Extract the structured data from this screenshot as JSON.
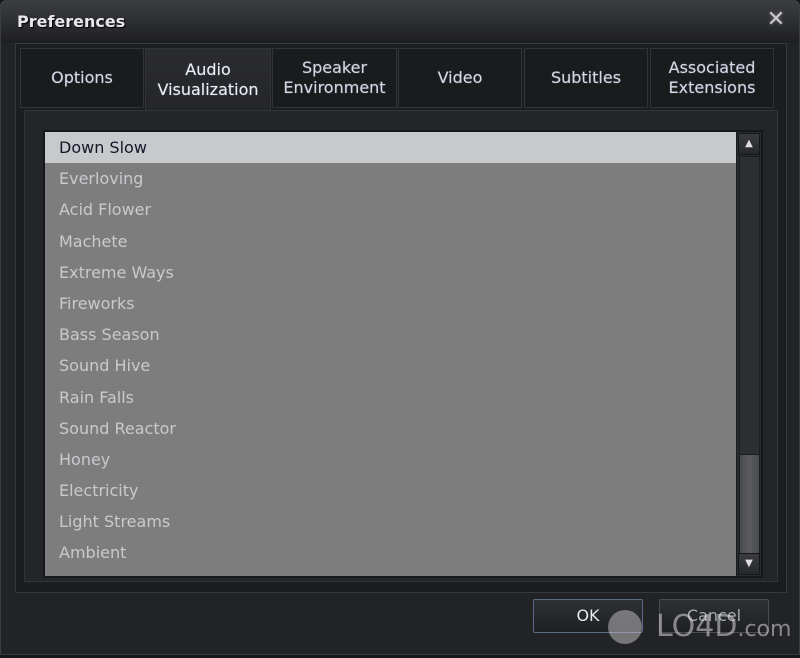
{
  "window": {
    "title": "Preferences",
    "close_icon": "close-icon"
  },
  "tabs": [
    {
      "line1": "Options",
      "line2": "",
      "active": false
    },
    {
      "line1": "Audio",
      "line2": "Visualization",
      "active": true
    },
    {
      "line1": "Speaker",
      "line2": "Environment",
      "active": false
    },
    {
      "line1": "Video",
      "line2": "",
      "active": false
    },
    {
      "line1": "Subtitles",
      "line2": "",
      "active": false
    },
    {
      "line1": "Associated",
      "line2": "Extensions",
      "active": false
    }
  ],
  "visualization_list": {
    "selected": "Down Slow",
    "items": [
      "Down Slow",
      "Everloving",
      "Acid Flower",
      "Machete",
      "Extreme Ways",
      "Fireworks",
      "Bass Season",
      "Sound Hive",
      "Rain Falls",
      "Sound Reactor",
      "Honey",
      "Electricity",
      "Light Streams",
      "Ambient"
    ],
    "scroll_position": 1.0,
    "visible_fraction": 0.8
  },
  "buttons": {
    "ok": "OK",
    "cancel": "Cancel"
  },
  "watermark": {
    "brand": "LO4D",
    "suffix": ".com"
  }
}
